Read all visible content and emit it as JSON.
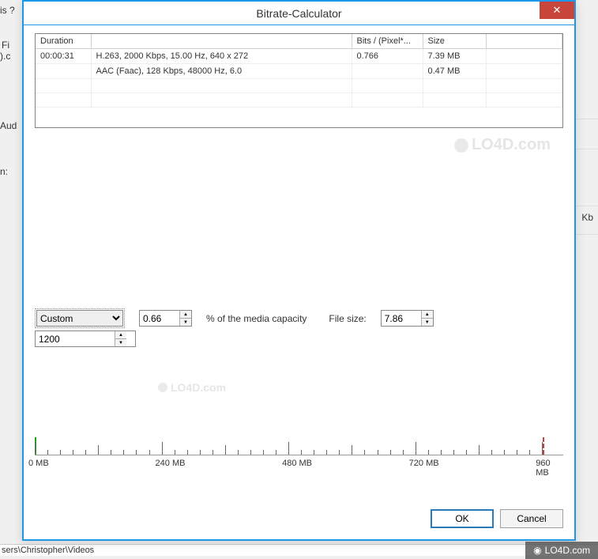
{
  "background": {
    "menu_frag": "is   ?",
    "label_fi": "Fi",
    "label_c": ").c",
    "label_aud": "Aud",
    "label_n": "n:",
    "label_kb": "Kb",
    "path": "sers\\Christopher\\Videos"
  },
  "dialog": {
    "title": "Bitrate-Calculator",
    "close": "✕"
  },
  "table": {
    "headers": {
      "duration": "Duration",
      "bits": "Bits / (Pixel*...",
      "size": "Size"
    },
    "rows": [
      {
        "duration": "00:00:31",
        "desc": "H.263, 2000 Kbps, 15.00 Hz, 640 x 272",
        "bits": "0.766",
        "size": "7.39 MB"
      },
      {
        "duration": "",
        "desc": "AAC (Faac), 128 Kbps, 48000 Hz, 6.0",
        "bits": "",
        "size": "0.47 MB"
      }
    ]
  },
  "controls": {
    "preset": "Custom",
    "bitrate": "1200",
    "percent": "0.66",
    "percent_label": "% of the media capacity",
    "filesize_label": "File size:",
    "filesize": "7.86"
  },
  "ruler": {
    "labels": [
      "0 MB",
      "240 MB",
      "480 MB",
      "720 MB",
      "960 MB"
    ]
  },
  "buttons": {
    "ok": "OK",
    "cancel": "Cancel"
  },
  "watermark": "LO4D.com"
}
